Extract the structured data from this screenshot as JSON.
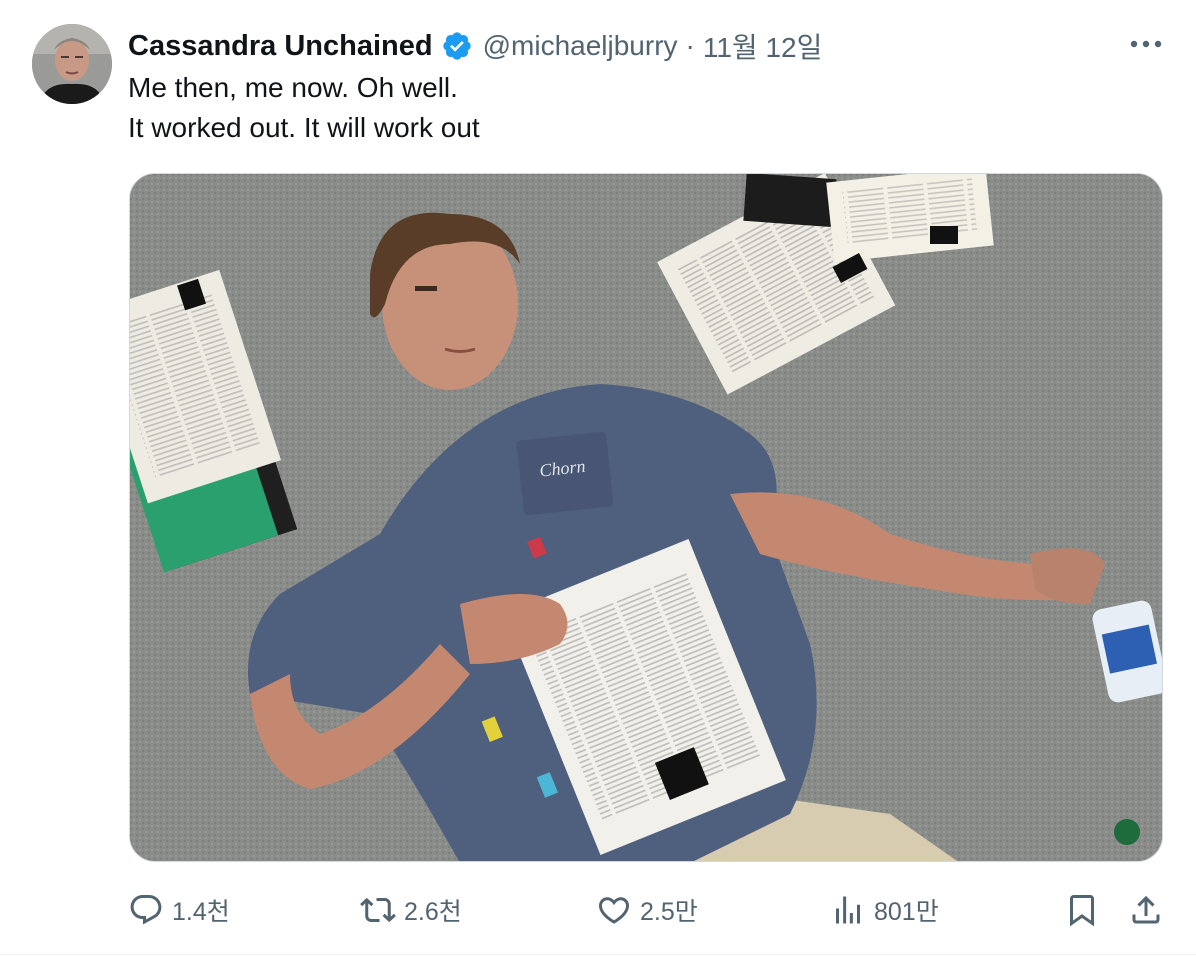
{
  "tweet": {
    "display_name": "Cassandra Unchained",
    "handle": "@michaeljburry",
    "separator": "·",
    "date": "11월 12일",
    "text_lines": [
      "Me then, me now. Oh well.",
      "It worked out. It will work out"
    ],
    "media": {
      "pocket_logo_text": "Chorn"
    }
  },
  "actions": {
    "reply_count": "1.4천",
    "retweet_count": "2.6천",
    "like_count": "2.5만",
    "view_count": "801만"
  },
  "colors": {
    "text_primary": "#0f1419",
    "text_secondary": "#536471",
    "verified_blue": "#1d9bf0",
    "border": "#cfd9de"
  }
}
